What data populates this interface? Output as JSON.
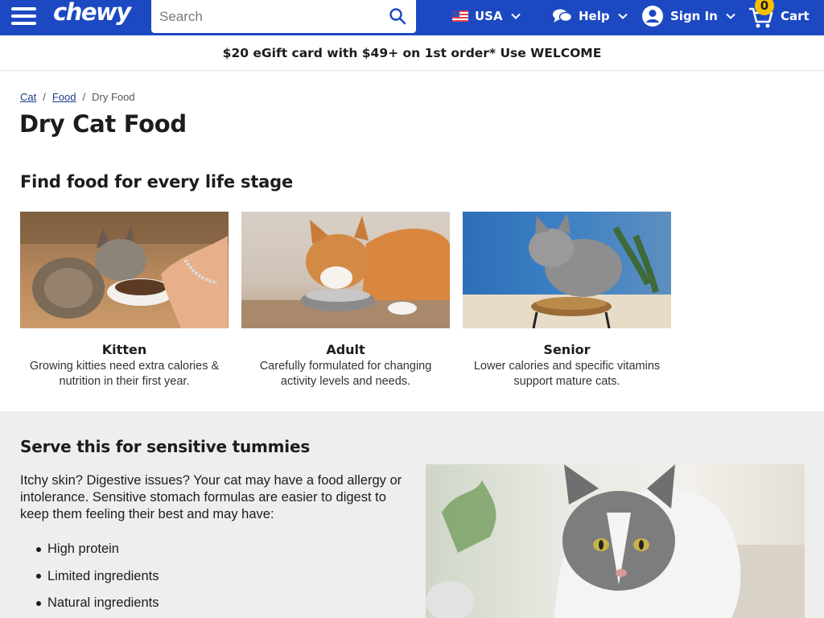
{
  "header": {
    "logo": "chewy",
    "search_placeholder": "Search",
    "country": "USA",
    "help_label": "Help",
    "signin_label": "Sign In",
    "cart_label": "Cart",
    "cart_count": "0",
    "brand_color": "#1c49c2",
    "badge_color": "#f5c000"
  },
  "promo": {
    "text": "$20 eGift card with $49+ on 1st order* Use WELCOME"
  },
  "breadcrumb": {
    "items": [
      "Cat",
      "Food"
    ],
    "current": "Dry Food",
    "separator": "/"
  },
  "page_title": "Dry Cat Food",
  "life_stage": {
    "title": "Find food for every life stage",
    "cards": [
      {
        "name": "Kitten",
        "desc": "Growing kitties need extra calories & nutrition in their first year."
      },
      {
        "name": "Adult",
        "desc": "Carefully formulated for changing activity levels and needs."
      },
      {
        "name": "Senior",
        "desc": "Lower calories and specific vitamins support mature cats."
      }
    ]
  },
  "sensitive": {
    "title": "Serve this for sensitive tummies",
    "text": "Itchy skin? Digestive issues? Your cat may have a food allergy or intolerance. Sensitive stomach formulas are easier to digest to keep them feeling their best and may have:",
    "bullets": [
      "High protein",
      "Limited ingredients",
      "Natural ingredients"
    ]
  }
}
